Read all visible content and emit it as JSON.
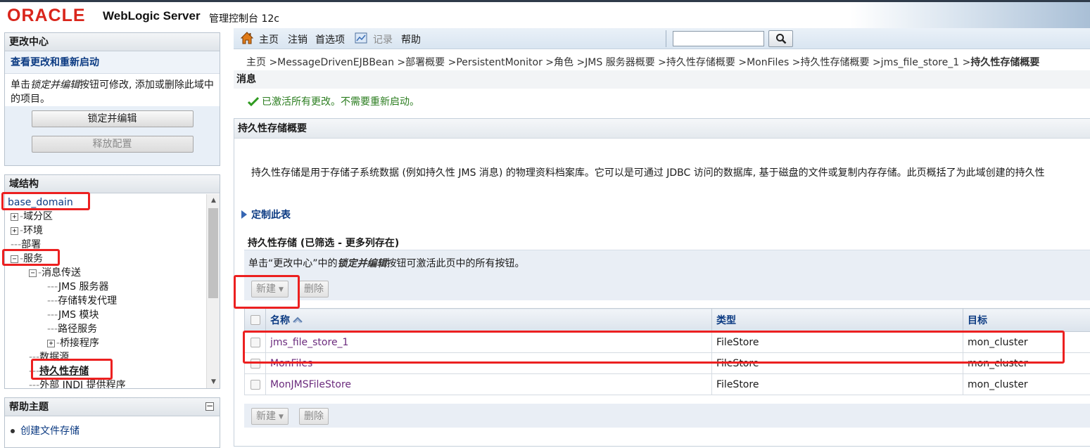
{
  "header": {
    "logo": "ORACLE",
    "product": "WebLogic Server",
    "console": "管理控制台 12c"
  },
  "change_center": {
    "title": "更改中心",
    "link": "查看更改和重新启动",
    "desc_prefix": "单击",
    "desc_em": "锁定并编辑",
    "desc_suffix": "按钮可修改, 添加或删除此域中的项目。",
    "lock_button": "锁定并编辑",
    "release_button": "释放配置"
  },
  "domain_structure": {
    "title": "域结构",
    "root": "base_domain",
    "items": [
      {
        "label": "域分区",
        "toggle": "+",
        "depth": 0
      },
      {
        "label": "环境",
        "toggle": "+",
        "depth": 0
      },
      {
        "label": "部署",
        "toggle": "",
        "depth": 0
      },
      {
        "label": "服务",
        "toggle": "−",
        "depth": 0
      },
      {
        "label": "消息传送",
        "toggle": "−",
        "depth": 1
      },
      {
        "label": "JMS 服务器",
        "toggle": "",
        "depth": 2
      },
      {
        "label": "存储转发代理",
        "toggle": "",
        "depth": 2
      },
      {
        "label": "JMS 模块",
        "toggle": "",
        "depth": 2
      },
      {
        "label": "路径服务",
        "toggle": "",
        "depth": 2
      },
      {
        "label": "桥接程序",
        "toggle": "+",
        "depth": 2
      },
      {
        "label": "数据源",
        "toggle": "",
        "depth": 1
      },
      {
        "label": "持久性存储",
        "toggle": "",
        "depth": 1
      },
      {
        "label": "外部 JNDI 提供程序",
        "toggle": "",
        "depth": 1
      }
    ]
  },
  "help": {
    "title": "帮助主题",
    "toggle": "−",
    "items": [
      "创建文件存储"
    ]
  },
  "toolbar": {
    "home": "主页",
    "logout": "注销",
    "preferences": "首选项",
    "record": "记录",
    "help": "帮助",
    "search_value": ""
  },
  "breadcrumb": {
    "path": "主页 >MessageDrivenEJBBean >部署概要 >PersistentMonitor >角色 >JMS 服务器概要 >持久性存储概要 >MonFiles >持久性存储概要 >jms_file_store_1 >",
    "current": "持久性存储概要"
  },
  "messages": {
    "title": "消息",
    "success": "已激活所有更改。不需要重新启动。"
  },
  "main": {
    "title": "持久性存储概要",
    "intro": "持久性存储是用于存储子系统数据 (例如持久性 JMS 消息) 的物理资料档案库。它可以是可通过 JDBC 访问的数据库, 基于磁盘的文件或复制内存存储。此页概括了为此域创建的持久性",
    "customize": "定制此表",
    "table_caption": "持久性存储 (已筛选 - 更多列存在)",
    "lock_note_prefix": "单击“更改中心”中的",
    "lock_note_em": "锁定并编辑",
    "lock_note_suffix": "按钮可激活此页中的所有按钮。",
    "new_button": "新建",
    "delete_button": "删除",
    "columns": [
      "名称",
      "类型",
      "目标"
    ],
    "rows": [
      {
        "name": "jms_file_store_1",
        "type": "FileStore",
        "target": "mon_cluster"
      },
      {
        "name": "MonFiles",
        "type": "FileStore",
        "target": "mon_cluster"
      },
      {
        "name": "MonJMSFileStore",
        "type": "FileStore",
        "target": "mon_cluster"
      }
    ]
  },
  "colors": {
    "oracle_red": "#d9251b",
    "link_blue": "#0b3a82",
    "visited_purple": "#6b2b7d",
    "success_green": "#2b7d1f",
    "annotation_red": "#ec2020"
  },
  "icons": [
    "home-icon",
    "record-icon",
    "search-icon",
    "check-icon",
    "triangle-right-icon",
    "sort-asc-icon",
    "chevron-down-icon"
  ]
}
